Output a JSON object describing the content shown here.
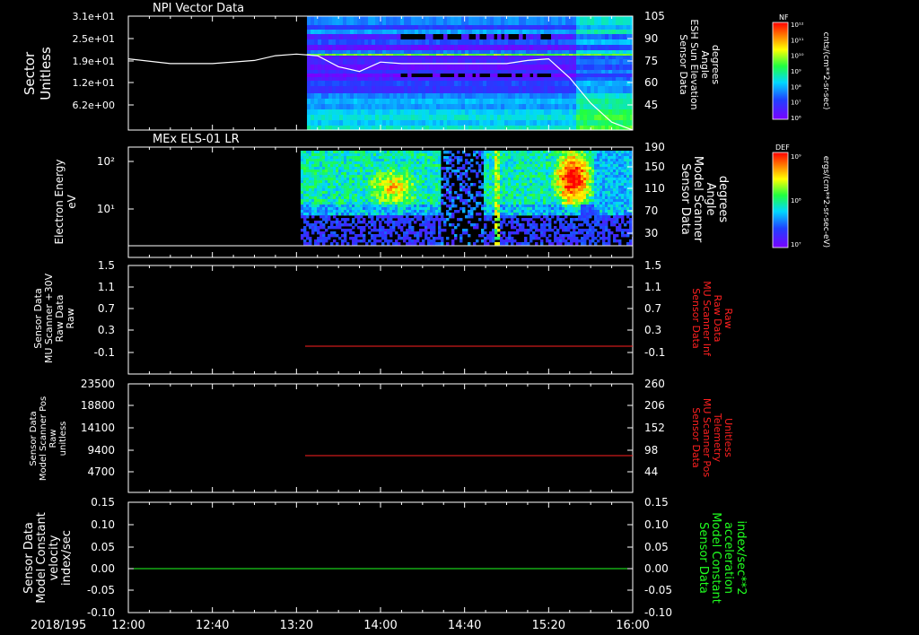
{
  "panels": [
    {
      "title": "NPI Vector Data",
      "left_label": [
        "Sector",
        "Unitless"
      ],
      "left_ticks": [
        "3.1e+01",
        "2.5e+01",
        "1.9e+01",
        "1.2e+01",
        "6.2e+00"
      ],
      "right_label": [
        "Sensor Data",
        "ESH Sun Elevation",
        "Angle",
        "degrees"
      ],
      "right_ticks": [
        "105",
        "90",
        "75",
        "60",
        "45"
      ],
      "colorbar_label": "NF",
      "colorbar_ticks": [
        "10¹²",
        "10¹¹",
        "10¹⁰",
        "10⁹",
        "10⁸",
        "10⁷",
        "10⁶"
      ],
      "colorbar_unit": "cnts/(cm**2-sr-sec)"
    },
    {
      "title": "MEx ELS-01 LR",
      "left_label": [
        "Electron Energy",
        "eV"
      ],
      "left_ticks": [
        "10²",
        "10¹"
      ],
      "right_label": [
        "Sensor Data",
        "Model Scanner",
        "Angle",
        "degrees"
      ],
      "right_ticks": [
        "190",
        "150",
        "110",
        "70",
        "30"
      ],
      "colorbar_label": "DEF",
      "colorbar_ticks": [
        "10⁹",
        "10⁸",
        "10⁷"
      ],
      "colorbar_unit": "ergs/(cm**2-sr-sec-eV)"
    },
    {
      "left_label": [
        "Sensor Data",
        "MU Scanner +30V",
        "Raw Data",
        "Raw"
      ],
      "left_ticks": [
        "1.5",
        "1.1",
        "0.7",
        "0.3",
        "-0.1"
      ],
      "right_label": [
        "Sensor Data",
        "MU Scanner Inf",
        "Raw Data",
        "Raw"
      ],
      "right_ticks": [
        "1.5",
        "1.1",
        "0.7",
        "0.3",
        "-0.1"
      ]
    },
    {
      "left_label": [
        "Sensor Data",
        "Model Scanner Pos",
        "Raw",
        "unitless"
      ],
      "left_ticks": [
        "23500",
        "18800",
        "14100",
        "9400",
        "4700"
      ],
      "right_label": [
        "Sensor Data",
        "MU Scanner Pos",
        "Telemetry",
        "Unitless"
      ],
      "right_ticks": [
        "260",
        "206",
        "152",
        "98",
        "44"
      ]
    },
    {
      "left_label": [
        "Sensor Data",
        "Model Constant",
        "velocity",
        "index/sec"
      ],
      "left_ticks": [
        "0.15",
        "0.10",
        "0.05",
        "0.00",
        "-0.05",
        "-0.10"
      ],
      "right_label": [
        "Sensor Data",
        "Model Constant",
        "acceleration",
        "index/sec**2"
      ],
      "right_ticks": [
        "0.15",
        "0.10",
        "0.05",
        "0.00",
        "-0.05",
        "-0.10"
      ]
    }
  ],
  "time_axis": {
    "date": "2018/195",
    "ticks": [
      "12:00",
      "12:40",
      "13:20",
      "14:00",
      "14:40",
      "15:20",
      "16:00"
    ]
  },
  "colors": {
    "background": "#000000",
    "foreground": "#ffffff",
    "red_axis": "#ff2020",
    "green_axis": "#20ff20"
  },
  "chart_data": [
    {
      "type": "heatmap",
      "title": "NPI Vector Data",
      "x_range": [
        "12:00",
        "16:00"
      ],
      "data_start": "13:25",
      "line_series": {
        "axis": "right",
        "x": [
          "12:00",
          "12:20",
          "12:40",
          "13:00",
          "13:10",
          "13:20",
          "13:30",
          "13:40",
          "13:50",
          "14:00",
          "14:10",
          "14:20",
          "14:40",
          "15:00",
          "15:10",
          "15:20",
          "15:30",
          "15:40",
          "15:50",
          "16:00"
        ],
        "y": [
          78,
          75,
          75,
          77,
          80,
          81,
          80,
          73,
          70,
          76,
          75,
          75,
          75,
          75,
          77,
          78,
          66,
          50,
          38,
          33
        ],
        "ylim": [
          33,
          105
        ]
      }
    },
    {
      "type": "heatmap",
      "title": "MEx ELS-01 LR",
      "x_range": [
        "12:00",
        "16:00"
      ],
      "data_start": "13:22",
      "ylabel": "Electron Energy",
      "features": [
        "enhancement ~13:55-14:05 near 20 eV",
        "intense burst ~15:20-15:40 up to 10²+ eV",
        "narrow spike ~14:55"
      ]
    },
    {
      "type": "line",
      "x": [
        "13:25",
        "16:00"
      ],
      "y": [
        -0.1,
        -0.1
      ],
      "ylim": [
        -0.3,
        1.5
      ],
      "color": "#ff2020"
    },
    {
      "type": "line",
      "x": [
        "13:25",
        "16:00"
      ],
      "y": [
        8800,
        8800
      ],
      "ylim": [
        0,
        23500
      ],
      "color": "#ff2020"
    },
    {
      "type": "line",
      "x": [
        "12:00",
        "16:00"
      ],
      "y": [
        0.0,
        0.0
      ],
      "ylim": [
        -0.1,
        0.15
      ],
      "color": "#20ff20"
    }
  ]
}
